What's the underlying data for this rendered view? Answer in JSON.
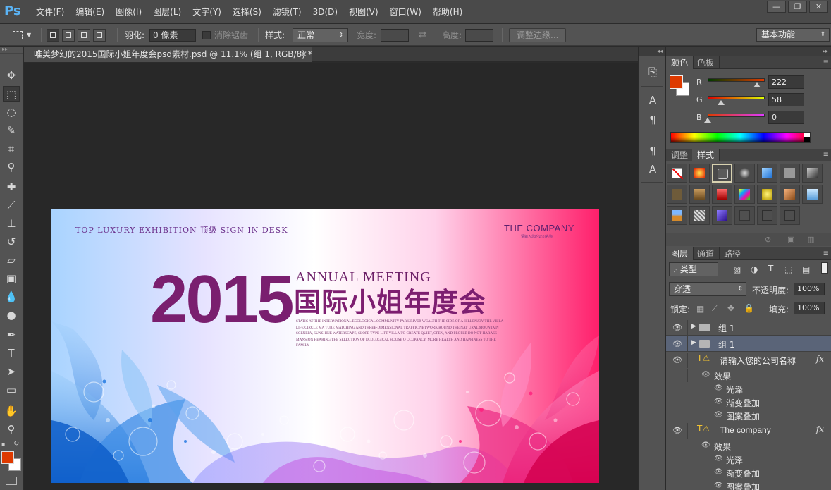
{
  "app": {
    "logo": "Ps"
  },
  "menu": [
    "文件(F)",
    "编辑(E)",
    "图像(I)",
    "图层(L)",
    "文字(Y)",
    "选择(S)",
    "滤镜(T)",
    "3D(D)",
    "视图(V)",
    "窗口(W)",
    "帮助(H)"
  ],
  "window_buttons": [
    "—",
    "❐",
    "✕"
  ],
  "options": {
    "feather_label": "羽化:",
    "feather_value": "0 像素",
    "antialias_label": "消除锯齿",
    "style_label": "样式:",
    "style_value": "正常",
    "width_label": "宽度:",
    "height_label": "高度:",
    "refine_edge": "调整边缘..."
  },
  "workspace_preset": "基本功能",
  "document": {
    "tab_title": "唯美梦幻的2015国际小姐年度会psd素材.psd @ 11.1% (组 1, RGB/8) *",
    "close": "✕"
  },
  "artwork": {
    "top_left": "TOP LUXURY EXHIBITION 顶级 SIGN IN DESK",
    "company": "THE COMPANY",
    "company_sub": "请输入您的公司名称",
    "year": "2015",
    "annual": "ANNUAL MEETING",
    "cn_title": "国际小姐年度会",
    "body": "STATIC AT THE INTERNATIONAL ECOLOGICAL COMMUNITY PARK RIVER WEALTH THE SIDE OF A HILLENJOY THE VILLA LIFE CIRCLE MA TURE MATCHING AND THREE-DIMENSIONAL TRAFFIC NETWORK,ROUND THE NAT URAL MOUNTAIN SCENERY, SUNSHINE WATERSCAPE, SLOPE TYPE LIFT VILLA,TO CREATE QUIET, OPEN, AND PEOPLE DO NOT HARASS MANSION HEARING,THE SELECTION OF ECOLOGICAL HOUSE O CCUPANCY, MORE HEALTH AND HAPPINESS TO THE FAMILY"
  },
  "color_panel": {
    "tabs": [
      "颜色",
      "色板"
    ],
    "fg": "#de3a00",
    "bg": "#ffffff",
    "channels": [
      {
        "label": "R",
        "value": "222",
        "level": 0.87
      },
      {
        "label": "G",
        "value": "58",
        "level": 0.23
      },
      {
        "label": "B",
        "value": "0",
        "level": 0.0
      }
    ]
  },
  "styles_panel": {
    "tabs": [
      "调整",
      "样式"
    ]
  },
  "layers_panel": {
    "tabs": [
      "图层",
      "通道",
      "路径"
    ],
    "filter_label": "类型",
    "blend_mode": "穿透",
    "opacity_label": "不透明度:",
    "opacity_value": "100%",
    "lock_label": "锁定:",
    "fill_label": "填充:",
    "fill_value": "100%",
    "layers": [
      {
        "name": "组 1",
        "kind": "group"
      },
      {
        "name": "组 1",
        "kind": "group",
        "selected": true
      },
      {
        "name": "请输入您的公司名称",
        "kind": "text"
      },
      {
        "name": "效果",
        "kind": "fx-head"
      },
      {
        "name": "光泽",
        "kind": "fx"
      },
      {
        "name": "渐变叠加",
        "kind": "fx"
      },
      {
        "name": "图案叠加",
        "kind": "fx"
      },
      {
        "name": "The company",
        "kind": "text"
      },
      {
        "name": "效果",
        "kind": "fx-head"
      },
      {
        "name": "光泽",
        "kind": "fx"
      },
      {
        "name": "渐变叠加",
        "kind": "fx"
      },
      {
        "name": "图案叠加",
        "kind": "fx"
      }
    ],
    "fx_symbol": "fx"
  },
  "colors": {
    "accent_blue": "#5ab3f5",
    "foreground": "#de3a00",
    "selected_layer": "#5a6478"
  }
}
